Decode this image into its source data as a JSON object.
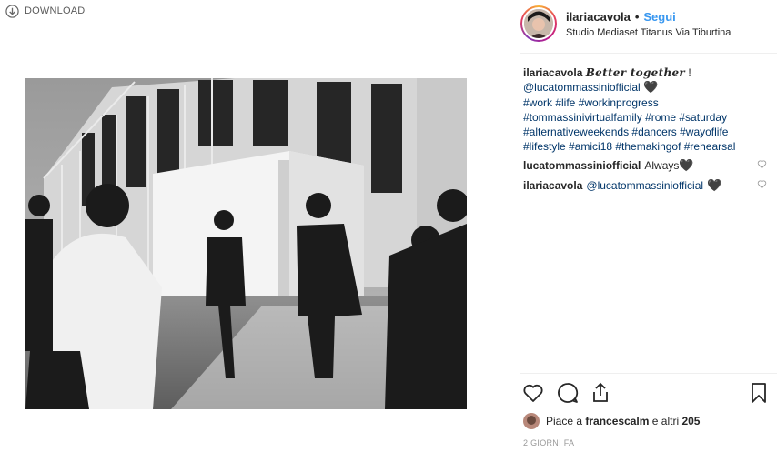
{
  "download": {
    "label": "DOWNLOAD",
    "icon": "download-circle-icon"
  },
  "post": {
    "author": "ilariacavola",
    "follow_label": "Segui",
    "separator": "•",
    "location": "Studio Mediaset Titanus Via Tiburtina"
  },
  "caption": {
    "user": "ilariacavola",
    "text": "Better together",
    "bang": "!",
    "mention": "@lucatommassiniofficial",
    "heart": "🖤",
    "hashtag_lines": [
      "#work #life #workinprogress",
      "#tommassinivirtualfamily #rome #saturday",
      "#alternativeweekends #dancers #wayoflife",
      "#lifestyle #amici18 #themakingof #rehearsal"
    ]
  },
  "comments": [
    {
      "user": "lucatommassiniofficial",
      "text": "Always",
      "heart": "🖤"
    },
    {
      "user": "ilariacavola",
      "mention": "@lucatommassiniofficial",
      "heart": "🖤"
    }
  ],
  "likes": {
    "prefix": "Piace a",
    "first_user": "francescalm",
    "suffix": "e altri",
    "count": "205"
  },
  "timestamp": "2 GIORNI FA",
  "colors": {
    "link": "#003569",
    "follow": "#3897f0",
    "text": "#262626",
    "muted": "#999999"
  }
}
